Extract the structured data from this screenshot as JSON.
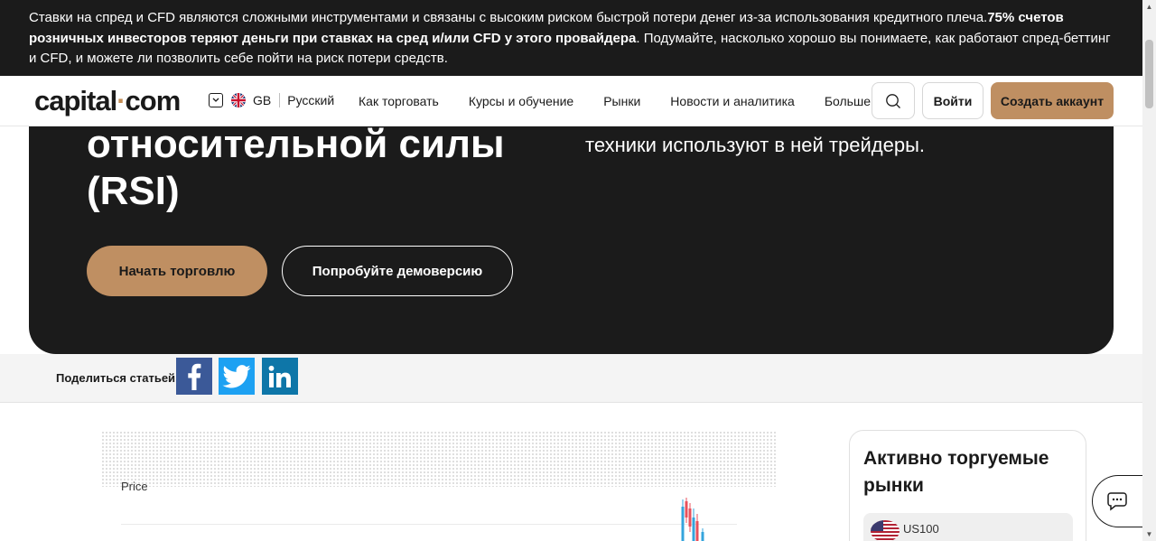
{
  "risk_warning": {
    "text_regular": "Ставки на спред и CFD являются сложными инструментами и связаны с высоким риском быстрой потери денег из-за использования кредитного плеча.",
    "text_bold": "75% счетов розничных инвесторов теряют деньги при ставках на сред и/или CFD у этого провайдера",
    "text_tail": ". Подумайте, насколько хорошо вы понимаете, как работают спред-беттинг и CFD, и можете ли позволить себе пойти на риск потери средств."
  },
  "header": {
    "logo_left": "capital",
    "logo_dot": "·",
    "logo_right": "com",
    "region": "GB",
    "language": "Русский",
    "nav": [
      "Как торговать",
      "Курсы и обучение",
      "Рынки",
      "Новости и аналитика",
      "Больше"
    ],
    "login_label": "Войти",
    "create_account_label": "Создать аккаунт"
  },
  "hero": {
    "title": "относительной силы (RSI)",
    "subtitle": "техники используют в ней трейдеры.",
    "start_trading_label": "Начать торговлю",
    "demo_label": "Попробуйте демоверсию"
  },
  "share": {
    "label": "Поделиться статьей",
    "buttons": [
      "facebook-icon",
      "twitter-icon",
      "linkedin-icon"
    ]
  },
  "chart": {
    "y_label": "Price"
  },
  "markets": {
    "title": "Активно торгуемые рынки",
    "items": [
      {
        "name": "US100",
        "flag": "us-flag-icon"
      }
    ]
  },
  "colors": {
    "accent": "#bf8f62",
    "dark": "#1b1b1b",
    "facebook": "#3b5998",
    "twitter": "#1da1f2",
    "linkedin": "#0e76a8"
  }
}
